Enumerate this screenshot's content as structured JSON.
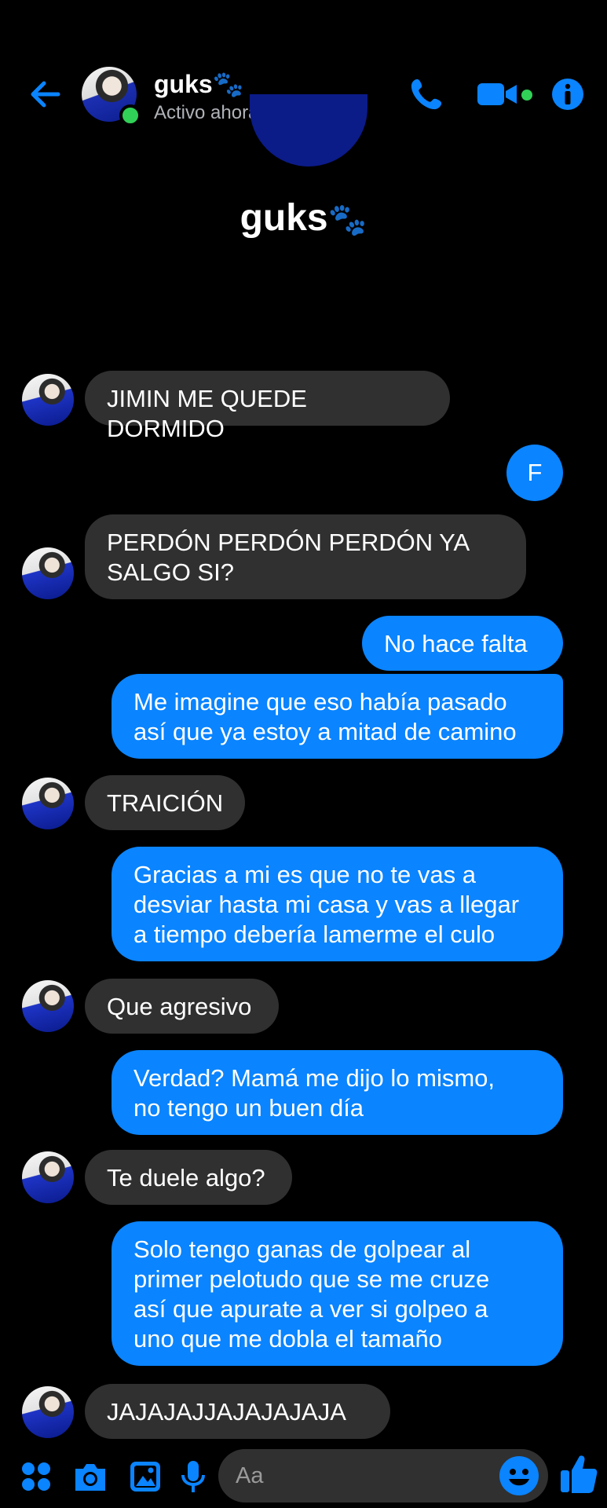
{
  "header": {
    "name": "guks🐾",
    "status": "Activo ahora"
  },
  "profile": {
    "name": "guks",
    "name_emoji": "🐾"
  },
  "messages": [
    {
      "from": "them",
      "text": "JIMIN ME QUEDE DORMIDO"
    },
    {
      "from": "me",
      "text": "F"
    },
    {
      "from": "them",
      "text": "PERDÓN PERDÓN PERDÓN YA\nSALGO SI?"
    },
    {
      "from": "me",
      "text": "No hace falta"
    },
    {
      "from": "me",
      "text": "Me imagine que eso había pasado\nasí que ya estoy a mitad de camino"
    },
    {
      "from": "them",
      "text": "TRAICIÓN"
    },
    {
      "from": "me",
      "text": "Gracias a mi es que no te vas a\ndesviar hasta mi casa y vas a llegar\na tiempo debería lamerme el culo"
    },
    {
      "from": "them",
      "text": "Que agresivo"
    },
    {
      "from": "me",
      "text": "Verdad? Mamá me dijo lo mismo,\nno tengo un buen día"
    },
    {
      "from": "them",
      "text": "Te duele algo?"
    },
    {
      "from": "me",
      "text": "Solo tengo ganas de golpear al\nprimer pelotudo que se me cruze\nasí que apurate a ver si golpeo a\nuno que me dobla el tamaño"
    },
    {
      "from": "them",
      "text": "JAJAJAJJAJAJAJAJA"
    }
  ],
  "composer": {
    "placeholder": "Aa"
  },
  "icons": [
    "back-arrow-icon",
    "phone-icon",
    "video-icon",
    "info-icon",
    "menu-grid-icon",
    "camera-icon",
    "gallery-icon",
    "microphone-icon",
    "emoji-icon",
    "thumbs-up-icon"
  ],
  "colors": {
    "accent": "#0a84ff",
    "received_bubble": "#303030",
    "online": "#31d158",
    "background": "#000000"
  }
}
